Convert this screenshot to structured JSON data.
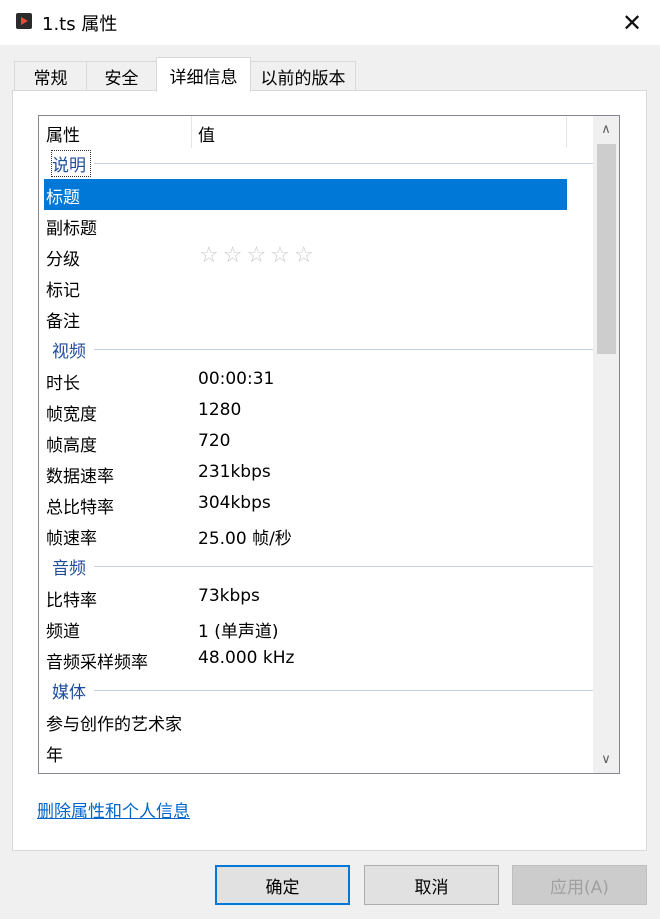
{
  "window": {
    "title": "1.ts 属性",
    "close_glyph": "✕"
  },
  "tabs": [
    {
      "label": "常规"
    },
    {
      "label": "安全"
    },
    {
      "label": "详细信息",
      "active": true
    },
    {
      "label": "以前的版本"
    }
  ],
  "list": {
    "header": {
      "property": "属性",
      "value": "值"
    },
    "groups": {
      "description": {
        "label": "说明",
        "title": {
          "name": "标题",
          "value": ""
        },
        "subtitle": {
          "name": "副标题",
          "value": ""
        },
        "rating": {
          "name": "分级",
          "stars": "☆☆☆☆☆",
          "value": 0,
          "max": 5
        },
        "tags": {
          "name": "标记",
          "value": ""
        },
        "comments": {
          "name": "备注",
          "value": ""
        }
      },
      "video": {
        "label": "视频",
        "length": {
          "name": "时长",
          "value": "00:00:31"
        },
        "frame_width": {
          "name": "帧宽度",
          "value": "1280"
        },
        "frame_height": {
          "name": "帧高度",
          "value": "720"
        },
        "data_rate": {
          "name": "数据速率",
          "value": "231kbps"
        },
        "total_bitrate": {
          "name": "总比特率",
          "value": "304kbps"
        },
        "frame_rate": {
          "name": "帧速率",
          "value": "25.00 帧/秒"
        }
      },
      "audio": {
        "label": "音频",
        "bitrate": {
          "name": "比特率",
          "value": "73kbps"
        },
        "channels": {
          "name": "频道",
          "value": "1 (单声道)"
        },
        "sample_rate": {
          "name": "音频采样频率",
          "value": "48.000 kHz"
        }
      },
      "media": {
        "label": "媒体",
        "contributing_artists": {
          "name": "参与创作的艺术家",
          "value": ""
        },
        "year": {
          "name": "年",
          "value": ""
        }
      }
    },
    "scroll": {
      "up_glyph": "∧",
      "down_glyph": "∨"
    }
  },
  "remove_link": "删除属性和个人信息",
  "buttons": {
    "ok": "确定",
    "cancel": "取消",
    "apply": "应用(A)"
  },
  "colors": {
    "selection": "#0078d7",
    "group_label": "#1e4e9b",
    "link": "#0066cc",
    "default_button_border": "#0078d7"
  }
}
